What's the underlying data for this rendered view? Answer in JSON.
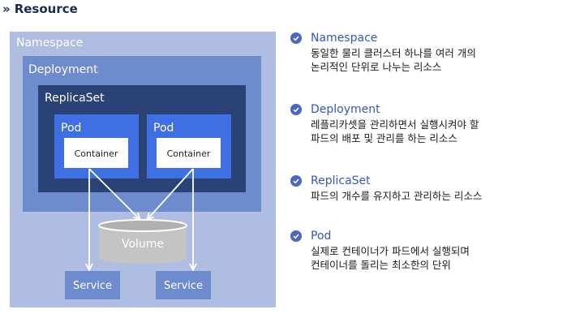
{
  "header": {
    "chevron": "»",
    "title": "Resource"
  },
  "diagram": {
    "namespace_label": "Namespace",
    "deployment_label": "Deployment",
    "replicaset_label": "ReplicaSet",
    "pods": [
      {
        "label": "Pod",
        "container": "Container"
      },
      {
        "label": "Pod",
        "container": "Container"
      }
    ],
    "volume_label": "Volume",
    "services": [
      "Service",
      "Service"
    ],
    "colors": {
      "namespace": "#aebde1",
      "deployment": "#6e8bce",
      "replicaset": "#2b4277",
      "pod": "#3e6fe3",
      "service": "#6e8bce",
      "volume": "#c4c4c4"
    }
  },
  "legend": [
    {
      "title": "Namespace",
      "desc": "동일한 물리 클러스터 하나를 여러 개의\n논리적인 단위로 나누는 리소스"
    },
    {
      "title": "Deployment",
      "desc": "레플리카셋을 관리하면서 실행시켜야 할\n파드의 배포 및 관리를 하는 리소스"
    },
    {
      "title": "ReplicaSet",
      "desc": "파드의 개수를 유지하고 관리하는 리소스"
    },
    {
      "title": "Pod",
      "desc": "실제로 컨테이너가 파드에서 실행되며\n컨테이너를 돌리는 최소한의 단위"
    }
  ]
}
